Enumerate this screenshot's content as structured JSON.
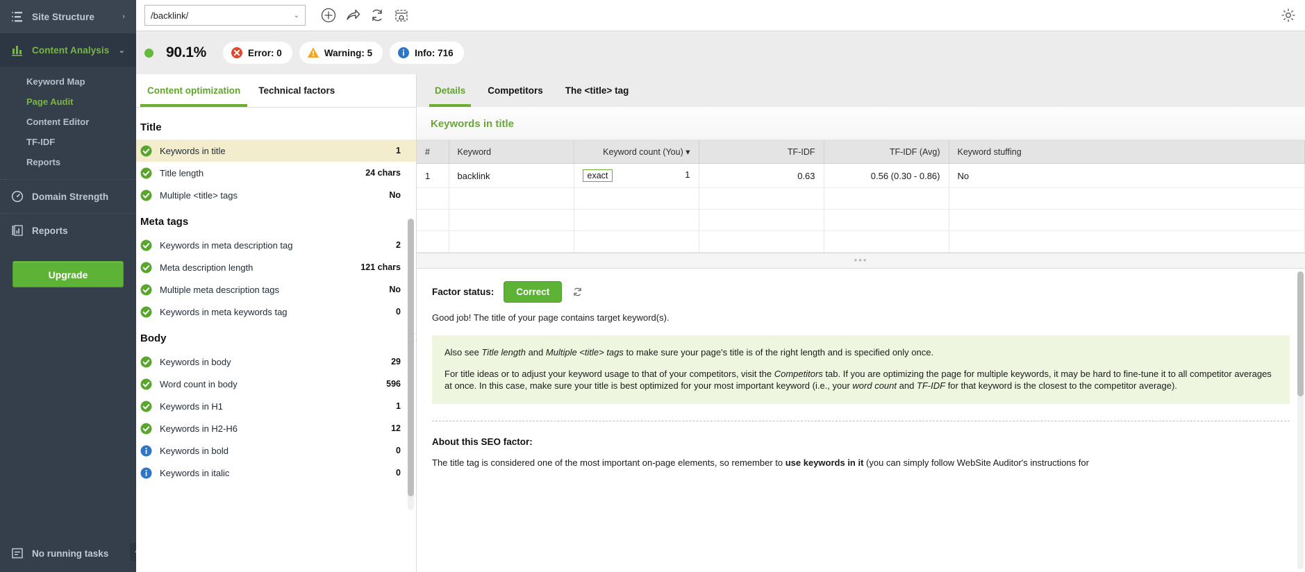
{
  "sidebar": {
    "top_item": {
      "label": "Site Structure",
      "icon": "list-structure-icon",
      "chevron": "›"
    },
    "group": {
      "label": "Content Analysis",
      "icon": "bar-chart-icon",
      "chevron": "⌄"
    },
    "sub_items": [
      {
        "label": "Keyword Map",
        "selected": false
      },
      {
        "label": "Page Audit",
        "selected": true
      },
      {
        "label": "Content Editor",
        "selected": false
      },
      {
        "label": "TF-IDF",
        "selected": false
      },
      {
        "label": "Reports",
        "selected": false
      }
    ],
    "items_after": [
      {
        "label": "Domain Strength",
        "icon": "gauge-icon"
      },
      {
        "label": "Reports",
        "icon": "report-doc-icon"
      }
    ],
    "upgrade_label": "Upgrade",
    "tasks_label": "No running tasks",
    "collapse_glyph": "‹"
  },
  "topbar": {
    "url_value": "/backlink/",
    "caret": "⌄",
    "icons": [
      "add-page-icon",
      "share-icon",
      "refresh-icon",
      "schedule-icon"
    ],
    "gear": "gear-icon"
  },
  "status": {
    "score": "90.1%",
    "pills": [
      {
        "icon": "error-icon",
        "label": "Error: 0",
        "color": "#e0472c"
      },
      {
        "icon": "warning-icon",
        "label": "Warning: 5",
        "color": "#f5a623"
      },
      {
        "icon": "info-icon",
        "label": "Info: 716",
        "color": "#2f77c4"
      }
    ]
  },
  "factors_panel": {
    "tabs": [
      {
        "label": "Content optimization",
        "selected": true
      },
      {
        "label": "Technical factors",
        "selected": false
      }
    ],
    "groups": [
      {
        "title": "Title",
        "rows": [
          {
            "status": "ok",
            "name": "Keywords in title",
            "value": "1",
            "highlighted": true
          },
          {
            "status": "ok",
            "name": "Title length",
            "value": "24 chars",
            "highlighted": false
          },
          {
            "status": "ok",
            "name": "Multiple <title> tags",
            "value": "No",
            "highlighted": false
          }
        ]
      },
      {
        "title": "Meta tags",
        "rows": [
          {
            "status": "ok",
            "name": "Keywords in meta description tag",
            "value": "2",
            "highlighted": false
          },
          {
            "status": "ok",
            "name": "Meta description length",
            "value": "121 chars",
            "highlighted": false
          },
          {
            "status": "ok",
            "name": "Multiple meta description tags",
            "value": "No",
            "highlighted": false
          },
          {
            "status": "ok",
            "name": "Keywords in meta keywords tag",
            "value": "0",
            "highlighted": false
          }
        ]
      },
      {
        "title": "Body",
        "rows": [
          {
            "status": "ok",
            "name": "Keywords in body",
            "value": "29",
            "highlighted": false
          },
          {
            "status": "ok",
            "name": "Word count in body",
            "value": "596",
            "highlighted": false
          },
          {
            "status": "ok",
            "name": "Keywords in H1",
            "value": "1",
            "highlighted": false
          },
          {
            "status": "ok",
            "name": "Keywords in H2-H6",
            "value": "12",
            "highlighted": false
          },
          {
            "status": "info",
            "name": "Keywords in bold",
            "value": "0",
            "highlighted": false
          },
          {
            "status": "info",
            "name": "Keywords in italic",
            "value": "0",
            "highlighted": false
          }
        ]
      }
    ]
  },
  "details_panel": {
    "tabs": [
      {
        "label": "Details",
        "selected": true
      },
      {
        "label": "Competitors",
        "selected": false
      },
      {
        "label": "The <title> tag",
        "selected": false
      }
    ],
    "title": "Keywords in title",
    "table": {
      "headers": [
        "#",
        "Keyword",
        "Keyword count (You)",
        "TF-IDF",
        "TF-IDF (Avg)",
        "Keyword stuffing"
      ],
      "sorted_column": "Keyword count (You)",
      "sort_caret": "▾",
      "rows": [
        {
          "num": "1",
          "keyword": "backlink",
          "match_type": "exact",
          "keyword_count": "1",
          "tfidf": "0.63",
          "tfidf_avg": "0.56 (0.30 - 0.86)",
          "stuffing": "No"
        }
      ],
      "empty_rows": 3
    },
    "grip_dots": "•••",
    "factor_status_label": "Factor status:",
    "factor_status_value": "Correct",
    "refresh_icon": "refresh-icon",
    "factor_status_note": "Good job! The title of your page contains target keyword(s).",
    "tips": [
      "Also see Title length and Multiple <title> tags to make sure your page's title is of the right length and is specified only once.",
      "For title ideas or to adjust your keyword usage to that of your competitors, visit the Competitors tab. If you are optimizing the page for multiple keywords, it may be hard to fine-tune it to all competitor averages at once. In this case, make sure your title is best optimized for your most important keyword (i.e., your word count and TF-IDF for that keyword is the closest to the competitor average).",
      "Also see ",
      "Title length",
      " and ",
      "Multiple <title> tags",
      " to make sure your page's title is of the right length and is specified only once."
    ],
    "tip1": {
      "p1": "Also see ",
      "em1": "Title length",
      "p2": " and ",
      "em2": "Multiple <title> tags",
      "p3": " to make sure your page's title is of the right length and is specified only once."
    },
    "tip2": {
      "p1": "For title ideas or to adjust your keyword usage to that of your competitors, visit the ",
      "em1": "Competitors",
      "p2": " tab. If you are optimizing the page for multiple keywords, it may be hard to fine-tune it to all competitor averages at once. In this case, make sure your title is best optimized for your most important keyword (i.e., your ",
      "em2": "word count",
      "p3": " and ",
      "em3": "TF-IDF",
      "p4": " for that keyword is the closest to the competitor average)."
    },
    "about_heading": "About this SEO factor:",
    "about": {
      "p1": "The title tag is considered one of the most important on-page elements, so remember to ",
      "b1": "use keywords in it",
      "p2": " (you can simply follow WebSite Auditor's instructions for"
    }
  },
  "colors": {
    "accent_green": "#6aad2f",
    "sidebar_bg": "#353f4c",
    "highlight_row": "#f4edcd",
    "tip_bg": "#eef6e0"
  }
}
